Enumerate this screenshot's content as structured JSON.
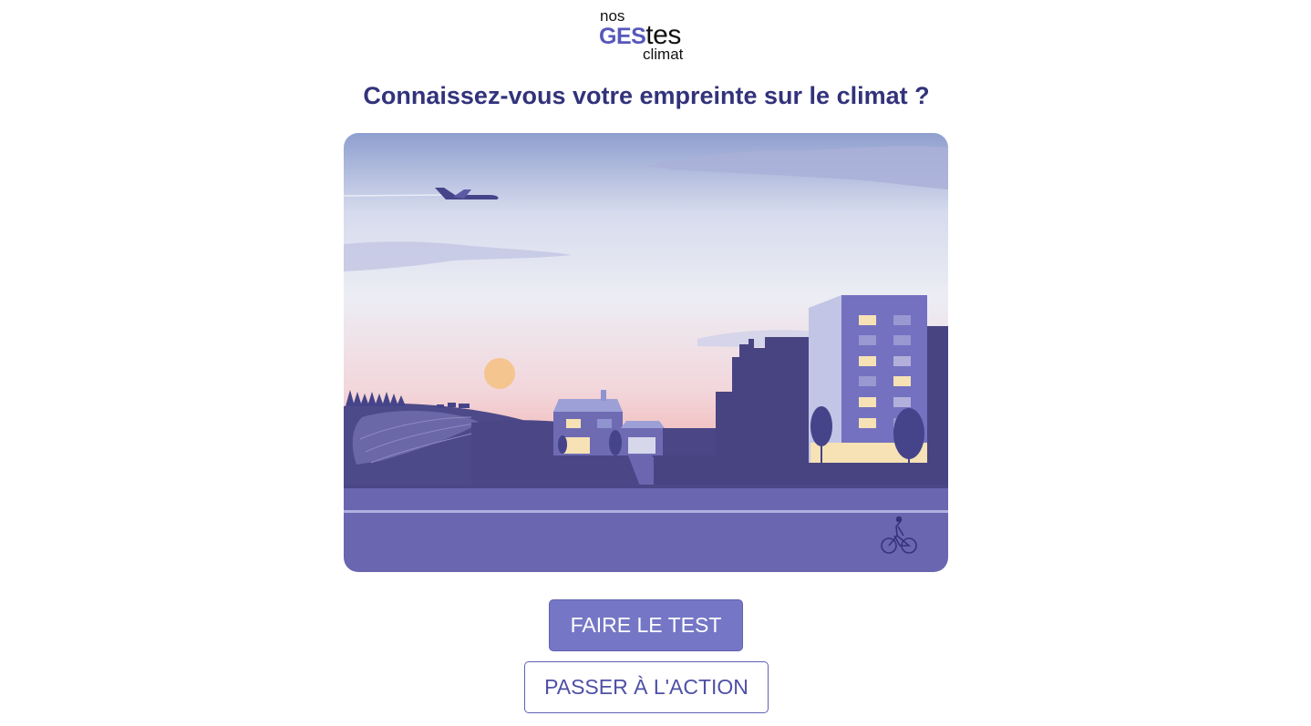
{
  "logo": {
    "line1": "nos",
    "line2_accent": "GES",
    "line2_rest": "tes",
    "line3": "climat"
  },
  "headline": "Connaissez-vous votre empreinte sur le climat ?",
  "hero": {
    "icons": [
      "airplane-icon",
      "sun-icon",
      "house-icon",
      "building-icon",
      "cyclist-icon",
      "cows-icon",
      "trees-icon"
    ]
  },
  "actions": {
    "primary_label": "FAIRE LE TEST",
    "secondary_label": "PASSER À L'ACTION"
  },
  "colors": {
    "brand": "#5758bb",
    "headline": "#32337b",
    "primary_button": "#7577c6",
    "road": "#6a66b0"
  }
}
